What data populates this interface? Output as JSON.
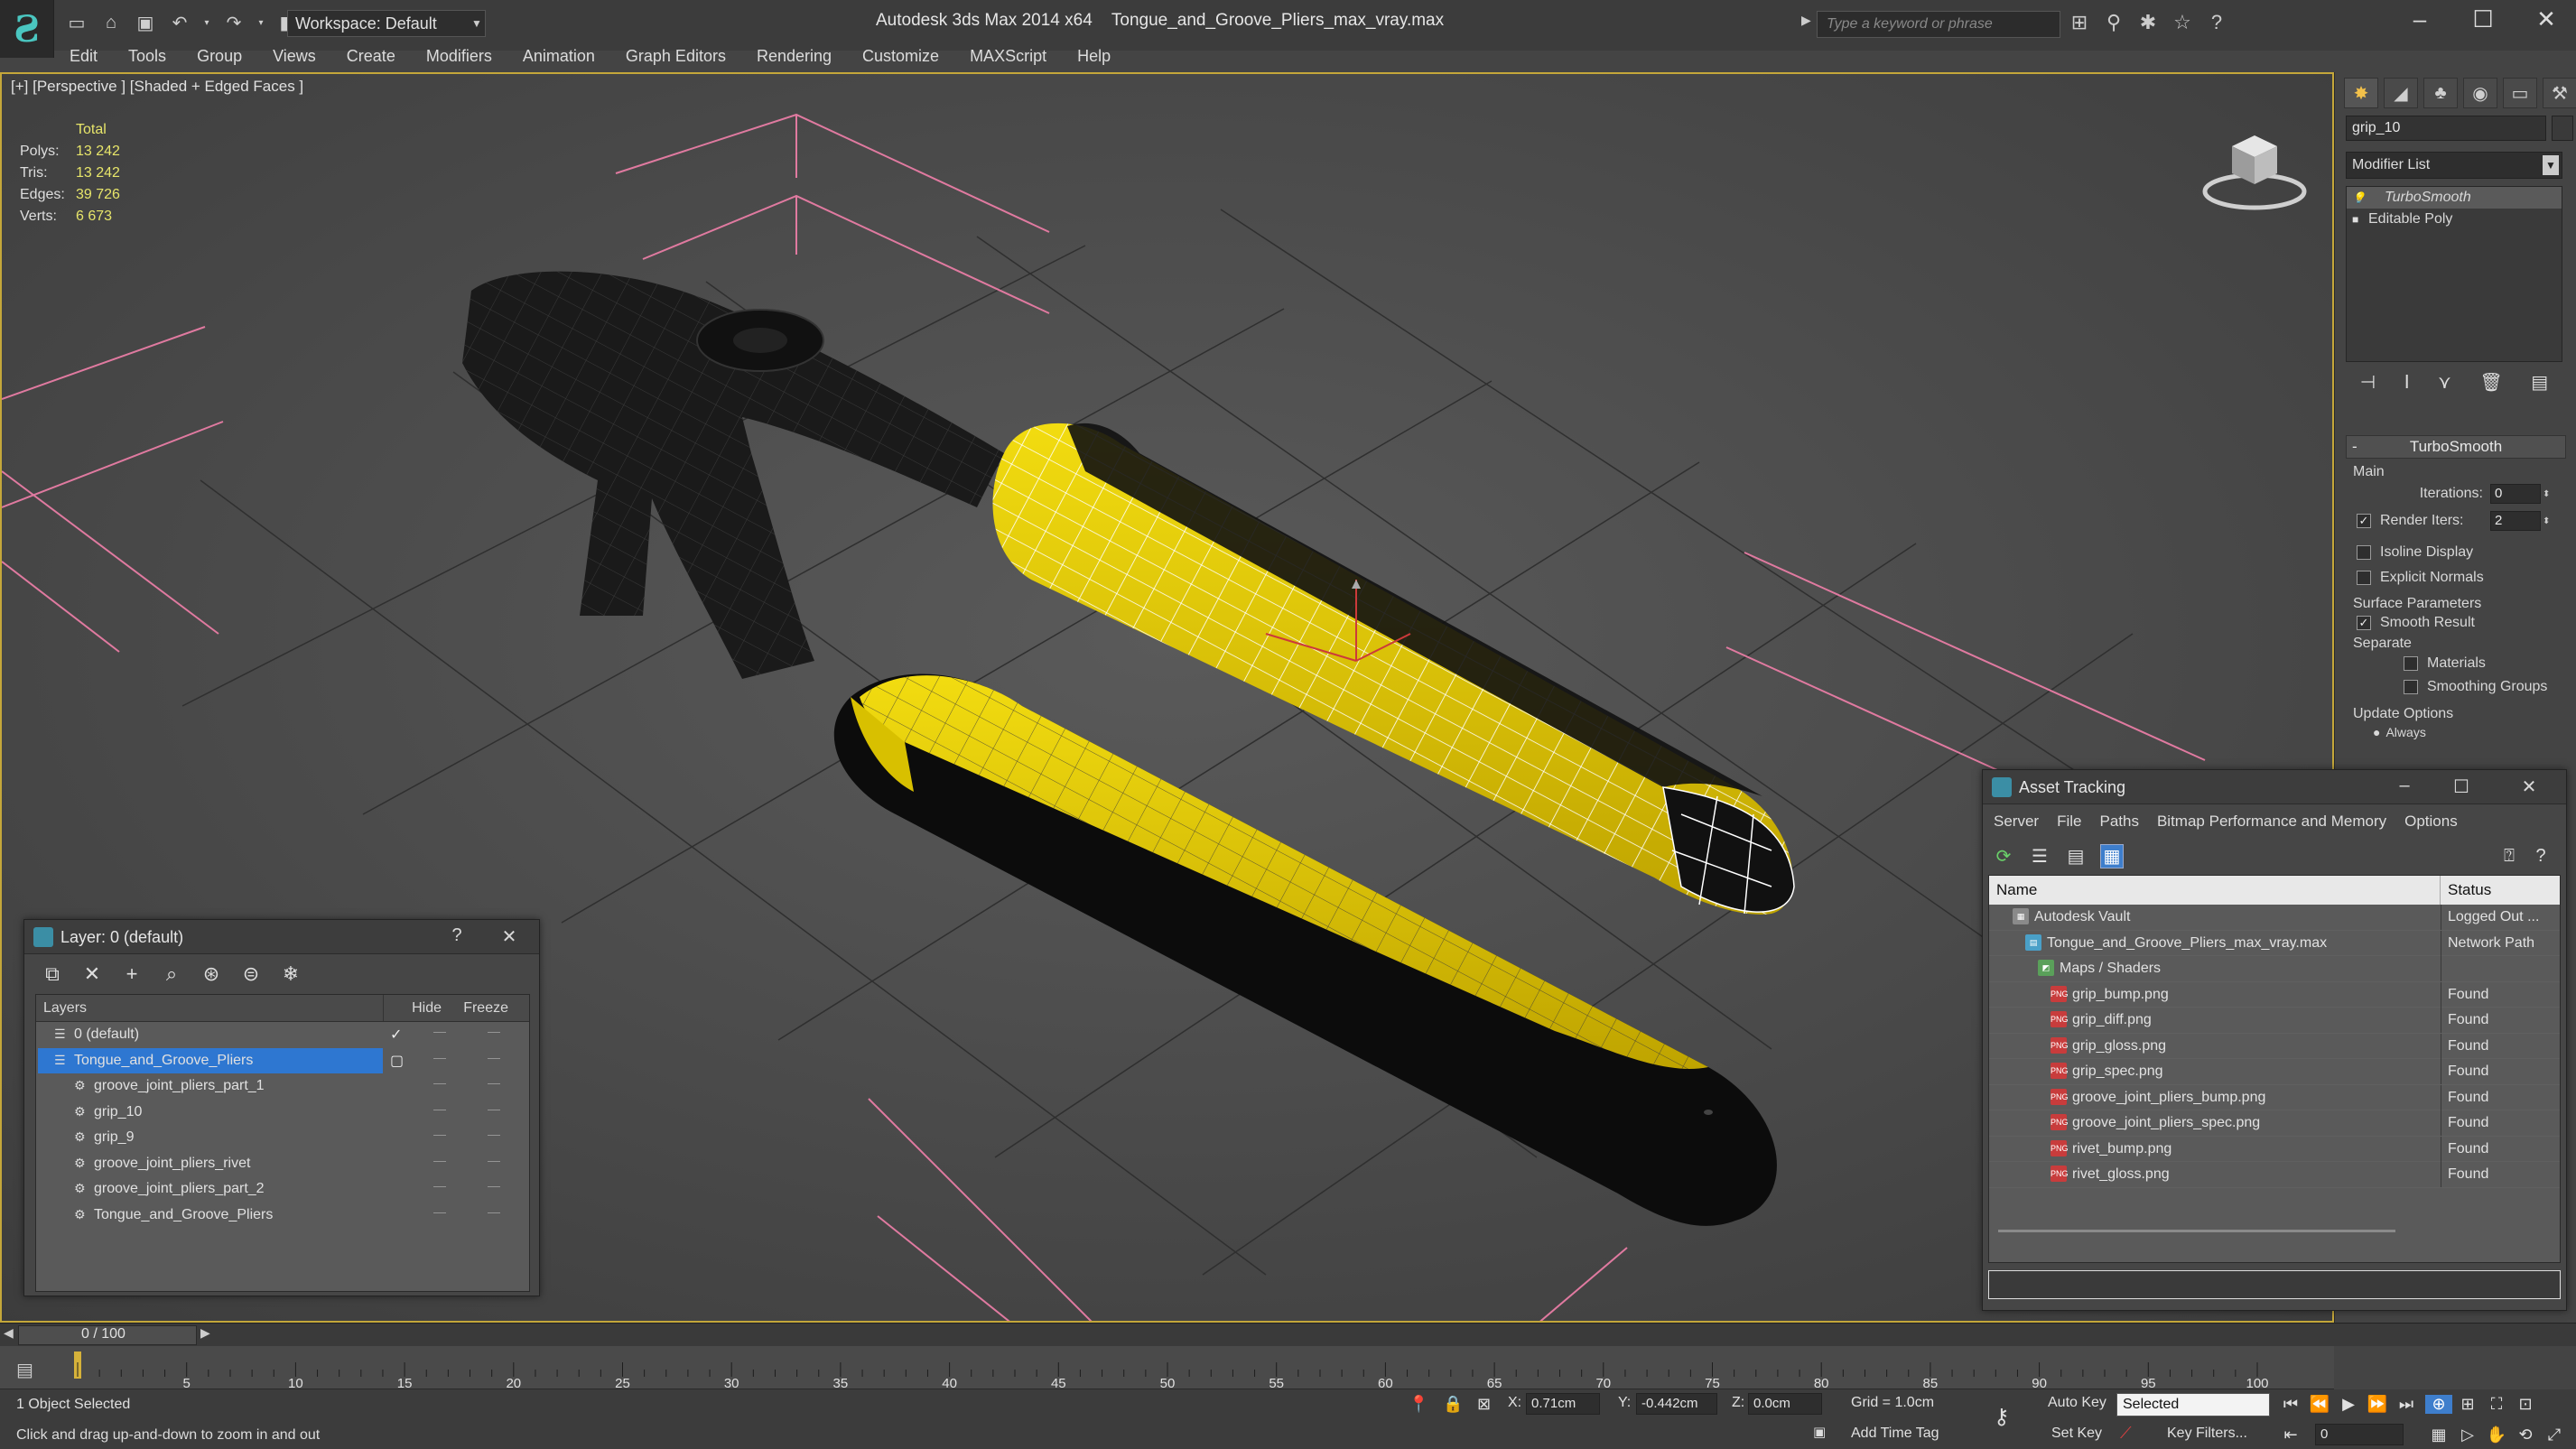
{
  "titlebar": {
    "workspace": "Workspace: Default",
    "app_title": "Autodesk 3ds Max  2014 x64",
    "file_title": "Tongue_and_Groove_Pliers_max_vray.max",
    "search_placeholder": "Type a keyword or phrase"
  },
  "menu": [
    "Edit",
    "Tools",
    "Group",
    "Views",
    "Create",
    "Modifiers",
    "Animation",
    "Graph Editors",
    "Rendering",
    "Customize",
    "MAXScript",
    "Help"
  ],
  "viewport": {
    "label": "[+] [Perspective ] [Shaded + Edged Faces ]",
    "stats_header": "Total",
    "stats": [
      {
        "k": "Polys:",
        "v": "13 242"
      },
      {
        "k": "Tris:",
        "v": "13 242"
      },
      {
        "k": "Edges:",
        "v": "39 726"
      },
      {
        "k": "Verts:",
        "v": "6 673"
      }
    ]
  },
  "command_panel": {
    "object_name": "grip_10",
    "modifier_list": "Modifier List",
    "stack": [
      {
        "label": "TurboSmooth",
        "selected": true
      },
      {
        "label": "Editable Poly",
        "selected": false
      }
    ],
    "rollout_title": "TurboSmooth",
    "main_label": "Main",
    "iterations_label": "Iterations:",
    "iterations_value": "0",
    "render_iters_label": "Render Iters:",
    "render_iters_value": "2",
    "isoline_label": "Isoline Display",
    "explicit_label": "Explicit Normals",
    "surface_label": "Surface Parameters",
    "smooth_label": "Smooth Result",
    "separate_label": "Separate",
    "materials_label": "Materials",
    "smoothing_groups_label": "Smoothing Groups",
    "update_label": "Update Options",
    "always_label": "Always"
  },
  "layer_window": {
    "title": "Layer: 0 (default)",
    "help": "?",
    "col_layers": "Layers",
    "col_hide": "Hide",
    "col_freeze": "Freeze",
    "rows": [
      {
        "name": "0 (default)",
        "indent": 0,
        "state": "✓",
        "selected": false
      },
      {
        "name": "Tongue_and_Groove_Pliers",
        "indent": 0,
        "state": "▢",
        "selected": true
      },
      {
        "name": "groove_joint_pliers_part_1",
        "indent": 1,
        "state": "",
        "selected": false
      },
      {
        "name": "grip_10",
        "indent": 1,
        "state": "",
        "selected": false
      },
      {
        "name": "grip_9",
        "indent": 1,
        "state": "",
        "selected": false
      },
      {
        "name": "groove_joint_pliers_rivet",
        "indent": 1,
        "state": "",
        "selected": false
      },
      {
        "name": "groove_joint_pliers_part_2",
        "indent": 1,
        "state": "",
        "selected": false
      },
      {
        "name": "Tongue_and_Groove_Pliers",
        "indent": 1,
        "state": "",
        "selected": false
      }
    ]
  },
  "asset_window": {
    "title": "Asset Tracking",
    "menu": [
      "Server",
      "File",
      "Paths",
      "Bitmap Performance and Memory",
      "Options"
    ],
    "col_name": "Name",
    "col_status": "Status",
    "rows": [
      {
        "name": "Autodesk Vault",
        "indent": 1,
        "icon": "vault",
        "status": "Logged Out ..."
      },
      {
        "name": "Tongue_and_Groove_Pliers_max_vray.max",
        "indent": 2,
        "icon": "max-file",
        "status": "Network Path"
      },
      {
        "name": "Maps / Shaders",
        "indent": 3,
        "icon": "maps",
        "status": ""
      },
      {
        "name": "grip_bump.png",
        "indent": 4,
        "icon": "png",
        "status": "Found"
      },
      {
        "name": "grip_diff.png",
        "indent": 4,
        "icon": "png",
        "status": "Found"
      },
      {
        "name": "grip_gloss.png",
        "indent": 4,
        "icon": "png",
        "status": "Found"
      },
      {
        "name": "grip_spec.png",
        "indent": 4,
        "icon": "png",
        "status": "Found"
      },
      {
        "name": "groove_joint_pliers_bump.png",
        "indent": 4,
        "icon": "png",
        "status": "Found"
      },
      {
        "name": "groove_joint_pliers_spec.png",
        "indent": 4,
        "icon": "png",
        "status": "Found"
      },
      {
        "name": "rivet_bump.png",
        "indent": 4,
        "icon": "png",
        "status": "Found"
      },
      {
        "name": "rivet_gloss.png",
        "indent": 4,
        "icon": "png",
        "status": "Found"
      }
    ]
  },
  "timeline": {
    "frame_label": "0 / 100",
    "ticks": [
      "5",
      "10",
      "15",
      "20",
      "25",
      "30",
      "35",
      "40",
      "45",
      "50",
      "55",
      "60",
      "65",
      "70",
      "75",
      "80",
      "85",
      "90",
      "95",
      "100"
    ]
  },
  "statusbar": {
    "selection": "1 Object Selected",
    "hint": "Click and drag up-and-down to zoom in and out",
    "x_label": "X:",
    "x_value": "0.71cm",
    "y_label": "Y:",
    "y_value": "-0.442cm",
    "z_label": "Z:",
    "z_value": "0.0cm",
    "grid": "Grid = 1.0cm",
    "add_time_tag": "Add Time Tag",
    "auto_key": "Auto Key",
    "set_key": "Set Key",
    "selected_dropdown": "Selected",
    "key_filters": "Key Filters...",
    "frame_value": "0"
  },
  "colors": {
    "grip_yellow": "#e6cc00",
    "grip_black": "#0c0c0c",
    "selection": "#2e77d1",
    "viewport_bg": "#4a4a4a",
    "grid_line": "#e07aa0"
  }
}
